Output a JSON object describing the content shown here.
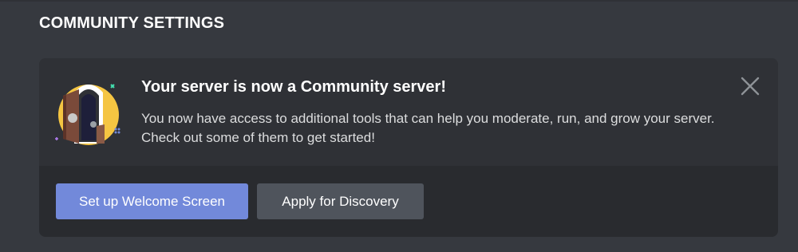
{
  "header": {
    "title": "COMMUNITY SETTINGS"
  },
  "banner": {
    "title": "Your server is now a Community server!",
    "description": "You now have access to additional tools that can help you moderate, run, and grow your server. Check out some of them to get started!",
    "illustration_icon": "open-door-icon",
    "close_icon": "close-icon",
    "buttons": {
      "primary_label": "Set up Welcome Screen",
      "secondary_label": "Apply for Discovery"
    }
  },
  "colors": {
    "background": "#36393f",
    "card": "#2f3136",
    "footer": "#292b2f",
    "primary_button": "#7289da",
    "secondary_button": "#4f545c",
    "illustration_circle": "#f5c542"
  }
}
